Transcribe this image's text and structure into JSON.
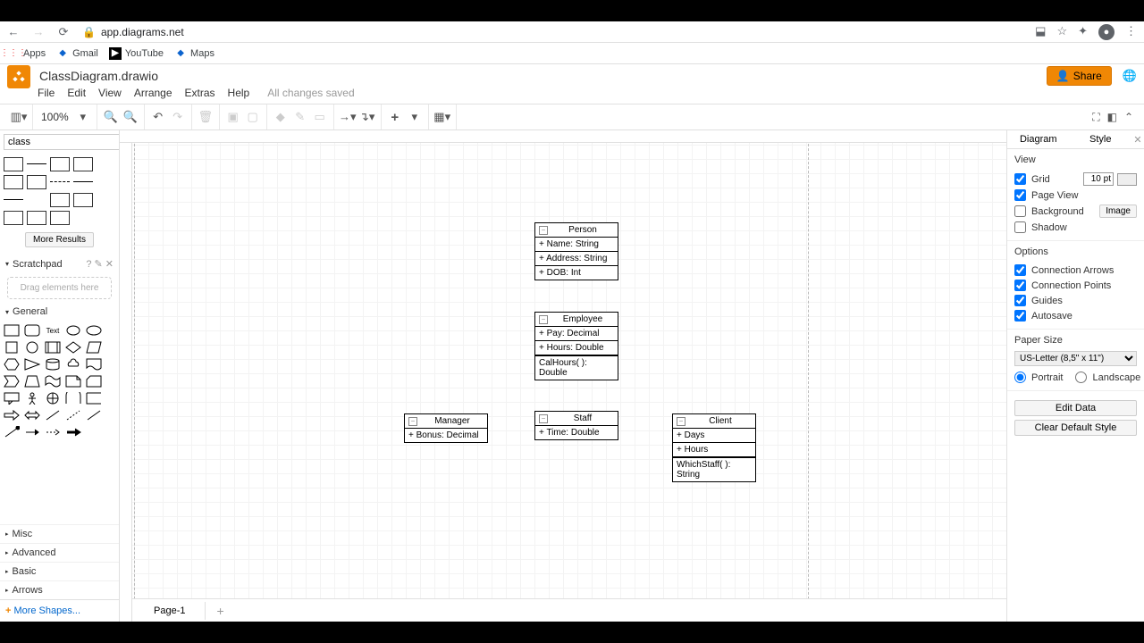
{
  "browser": {
    "url": "app.diagrams.net",
    "bookmarks": [
      "Apps",
      "Gmail",
      "YouTube",
      "Maps"
    ]
  },
  "document": {
    "title": "ClassDiagram.drawio",
    "save_status": "All changes saved",
    "share_label": "Share"
  },
  "menus": [
    "File",
    "Edit",
    "View",
    "Arrange",
    "Extras",
    "Help"
  ],
  "toolbar": {
    "zoom": "100%"
  },
  "sidebar": {
    "search_value": "class",
    "more_results": "More Results",
    "scratchpad": "Scratchpad",
    "drag_hint": "Drag elements here",
    "general": "General",
    "misc": "Misc",
    "advanced": "Advanced",
    "basic": "Basic",
    "arrows": "Arrows",
    "more_shapes": "More Shapes..."
  },
  "diagram": {
    "classes": {
      "person": {
        "name": "Person",
        "attrs": [
          "+ Name: String",
          "+ Address: String",
          "+ DOB: Int"
        ]
      },
      "employee": {
        "name": "Employee",
        "attrs": [
          "+ Pay: Decimal",
          "+ Hours: Double"
        ],
        "ops": [
          "CalHours( ): Double"
        ]
      },
      "manager": {
        "name": "Manager",
        "attrs": [
          "+ Bonus: Decimal"
        ]
      },
      "staff": {
        "name": "Staff",
        "attrs": [
          "+ Time: Double"
        ]
      },
      "client": {
        "name": "Client",
        "attrs": [
          "+ Days",
          "+ Hours"
        ],
        "ops": [
          "WhichStaff( ): String"
        ]
      }
    }
  },
  "rpanel": {
    "tabs": [
      "Diagram",
      "Style"
    ],
    "view_label": "View",
    "grid_label": "Grid",
    "grid_value": "10 pt",
    "pageview_label": "Page View",
    "background_label": "Background",
    "image_btn": "Image",
    "shadow_label": "Shadow",
    "options_label": "Options",
    "conn_arrows": "Connection Arrows",
    "conn_points": "Connection Points",
    "guides": "Guides",
    "autosave": "Autosave",
    "papersize_label": "Paper Size",
    "papersize_value": "US-Letter (8,5\" x 11\")",
    "portrait": "Portrait",
    "landscape": "Landscape",
    "edit_data": "Edit Data",
    "clear_style": "Clear Default Style"
  },
  "footer": {
    "page": "Page-1"
  }
}
